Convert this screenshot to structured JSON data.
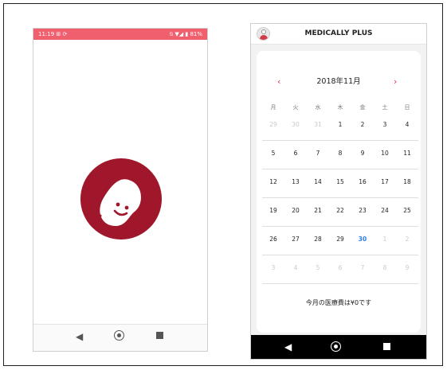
{
  "phone1": {
    "status": {
      "time": "11:19",
      "left_icons": "⊞ ⟳",
      "right_icons": "⍉ ▼◢ ▮",
      "battery": "81%"
    },
    "colors": {
      "statusbar": "#ef5f6e",
      "logo": "#a0172c"
    },
    "icons": [
      "back-icon",
      "home-icon",
      "recents-icon"
    ]
  },
  "phone2": {
    "app_title": "MEDICALLY PLUS",
    "month": "2018年11月",
    "prev_arrow": "‹",
    "next_arrow": "›",
    "weekdays": [
      "月",
      "火",
      "水",
      "木",
      "金",
      "土",
      "日"
    ],
    "weeks": [
      [
        {
          "d": "29",
          "faded": true
        },
        {
          "d": "30",
          "faded": true
        },
        {
          "d": "31",
          "faded": true
        },
        {
          "d": "1"
        },
        {
          "d": "2"
        },
        {
          "d": "3"
        },
        {
          "d": "4"
        }
      ],
      [
        {
          "d": "5"
        },
        {
          "d": "6"
        },
        {
          "d": "7"
        },
        {
          "d": "8"
        },
        {
          "d": "9"
        },
        {
          "d": "10"
        },
        {
          "d": "11"
        }
      ],
      [
        {
          "d": "12"
        },
        {
          "d": "13"
        },
        {
          "d": "14"
        },
        {
          "d": "15"
        },
        {
          "d": "16"
        },
        {
          "d": "17"
        },
        {
          "d": "18"
        }
      ],
      [
        {
          "d": "19"
        },
        {
          "d": "20"
        },
        {
          "d": "21"
        },
        {
          "d": "22"
        },
        {
          "d": "23"
        },
        {
          "d": "24"
        },
        {
          "d": "25"
        }
      ],
      [
        {
          "d": "26"
        },
        {
          "d": "27"
        },
        {
          "d": "28"
        },
        {
          "d": "29"
        },
        {
          "d": "30",
          "today": true
        },
        {
          "d": "1",
          "faded": true
        },
        {
          "d": "2",
          "faded": true
        }
      ],
      [
        {
          "d": "3",
          "faded": true
        },
        {
          "d": "4",
          "faded": true
        },
        {
          "d": "5",
          "faded": true
        },
        {
          "d": "6",
          "faded": true
        },
        {
          "d": "7",
          "faded": true
        },
        {
          "d": "8",
          "faded": true
        },
        {
          "d": "9",
          "faded": true
        }
      ]
    ],
    "summary": "今月の医療費は¥0です",
    "colors": {
      "accent": "#d2344a",
      "today": "#2a7de1"
    }
  }
}
